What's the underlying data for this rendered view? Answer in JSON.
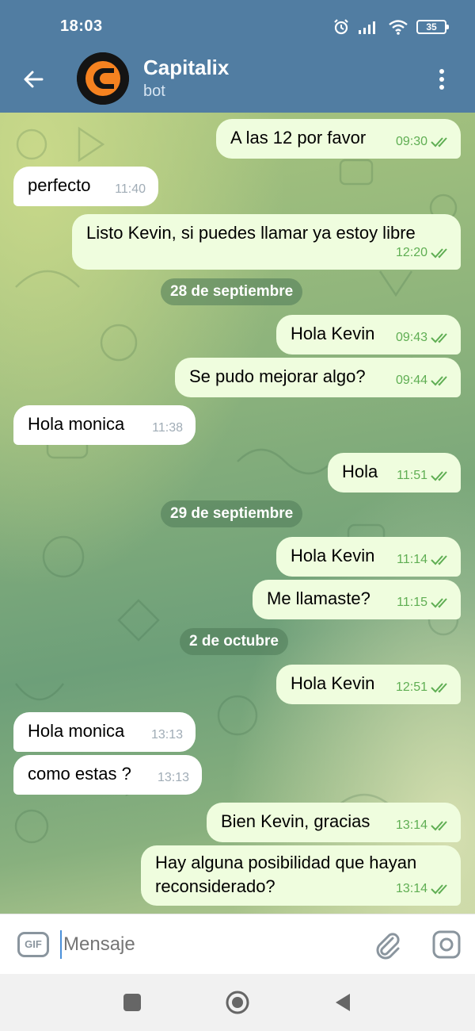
{
  "status_bar": {
    "time": "18:03",
    "battery": "35"
  },
  "header": {
    "title": "Capitalix",
    "subtitle": "bot"
  },
  "messages": [
    {
      "text": "A las 12 por favor",
      "time": "09:30",
      "dir": "out"
    },
    {
      "text": "perfecto",
      "time": "11:40",
      "dir": "in"
    },
    {
      "text": "Listo Kevin, si puedes llamar ya estoy libre",
      "time": "12:20",
      "dir": "out"
    },
    {
      "text": "Hola Kevin",
      "time": "09:43",
      "dir": "out"
    },
    {
      "text": "Se pudo mejorar algo?",
      "time": "09:44",
      "dir": "out"
    },
    {
      "text": "Hola monica",
      "time": "11:38",
      "dir": "in"
    },
    {
      "text": "Hola",
      "time": "11:51",
      "dir": "out"
    },
    {
      "text": "Hola Kevin",
      "time": "11:14",
      "dir": "out"
    },
    {
      "text": "Me llamaste?",
      "time": "11:15",
      "dir": "out"
    },
    {
      "text": "Hola Kevin",
      "time": "12:51",
      "dir": "out"
    },
    {
      "text": "Hola monica",
      "time": "13:13",
      "dir": "in"
    },
    {
      "text": "como estas ?",
      "time": "13:13",
      "dir": "in"
    },
    {
      "text": "Bien Kevin, gracias",
      "time": "13:14",
      "dir": "out"
    },
    {
      "text_line1": "Hay alguna posibilidad que hayan",
      "text_line2": "reconsiderado?",
      "time": "13:14",
      "dir": "out"
    }
  ],
  "date_separators": [
    "28 de septiembre",
    "29 de septiembre",
    "2 de octubre"
  ],
  "input": {
    "placeholder": "Mensaje",
    "gif_label": "GIF"
  },
  "colors": {
    "header": "#517da2",
    "outgoing_bubble": "#effdde",
    "incoming_bubble": "#ffffff",
    "read_ticks": "#5fae53"
  }
}
